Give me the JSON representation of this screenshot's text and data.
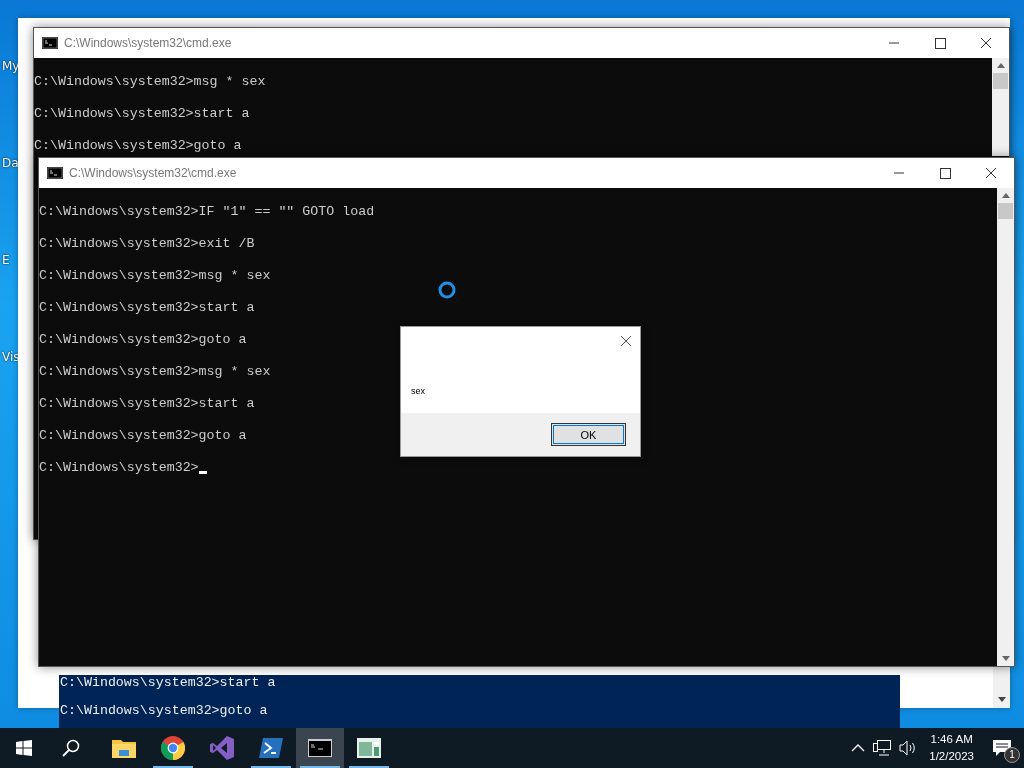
{
  "desktop": {
    "icon_labels": [
      "My",
      "Da",
      "E",
      "Vis"
    ]
  },
  "background_console": {
    "lines": [
      "C:\\Windows\\system32>start a",
      "C:\\Windows\\system32>goto a"
    ]
  },
  "windows": [
    {
      "title": "C:\\Windows\\system32\\cmd.exe",
      "lines": [
        "C:\\Windows\\system32>msg * sex",
        "C:\\Windows\\system32>start a",
        "C:\\Windows\\system32>goto a"
      ],
      "cursor": false
    },
    {
      "title": "C:\\Windows\\system32\\cmd.exe",
      "lines": [
        "C:\\Windows\\system32>IF \"1\" == \"\" GOTO load",
        "C:\\Windows\\system32>exit /B",
        "C:\\Windows\\system32>msg * sex",
        "C:\\Windows\\system32>start a",
        "C:\\Windows\\system32>goto a",
        "C:\\Windows\\system32>msg * sex",
        "C:\\Windows\\system32>start a",
        "C:\\Windows\\system32>goto a",
        "C:\\Windows\\system32>"
      ],
      "cursor": true
    }
  ],
  "message_box": {
    "text": "sex",
    "buttons": [
      "OK"
    ]
  },
  "taskbar": {
    "apps": [
      {
        "kind": "explorer",
        "selected": false,
        "running": false
      },
      {
        "kind": "chrome",
        "selected": false,
        "running": true
      },
      {
        "kind": "visual-studio",
        "selected": false,
        "running": false
      },
      {
        "kind": "powershell",
        "selected": false,
        "running": true
      },
      {
        "kind": "console",
        "selected": true,
        "running": true
      },
      {
        "kind": "monitor",
        "selected": false,
        "running": true
      }
    ],
    "time": "1:46 AM",
    "date": "1/2/2023",
    "notification_count": "1"
  }
}
